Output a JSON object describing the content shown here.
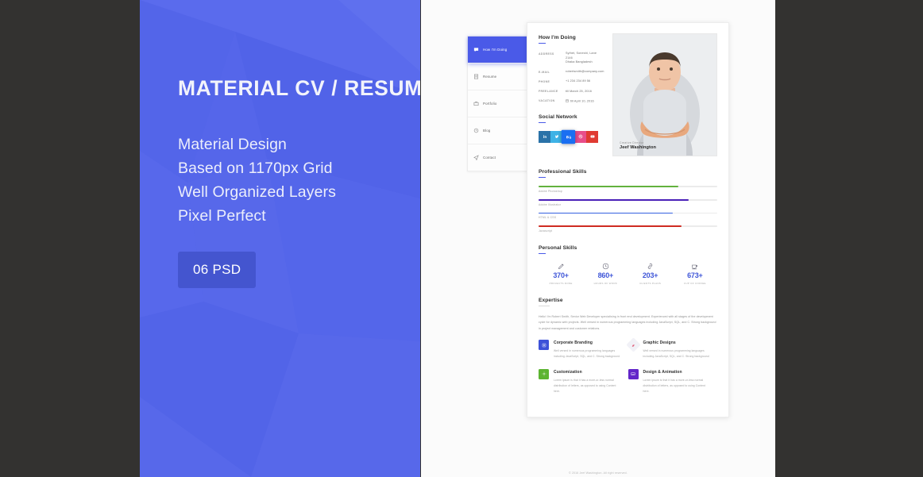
{
  "theme": {
    "promo_blue": "#5566ea",
    "badge_blue": "#4455cf",
    "accent": "#4a5ae8",
    "counter_blue": "#3f56d8",
    "page_bg": "#333230"
  },
  "promo": {
    "title": "MATERIAL CV / RESUME",
    "features": [
      "Material Design",
      "Based on 1170px Grid",
      "Well Organized Layers",
      "Pixel Perfect"
    ],
    "badge": "06 PSD"
  },
  "preview": {
    "nav": [
      {
        "label": "How I'm Doing",
        "icon": "chat-icon",
        "active": true
      },
      {
        "label": "Resume",
        "icon": "document-icon",
        "active": false
      },
      {
        "label": "Portfolio",
        "icon": "briefcase-icon",
        "active": false
      },
      {
        "label": "Blog",
        "icon": "comment-icon",
        "active": false
      },
      {
        "label": "Contact",
        "icon": "send-icon",
        "active": false
      }
    ],
    "header": {
      "title": "How I'm Doing",
      "contact": [
        {
          "key": "ADDRESS",
          "lines": [
            "Sylhet, Soneshi, Lane 2146",
            "Dhaka Bangladesh"
          ]
        },
        {
          "key": "E-MAIL",
          "lines": [
            "robertsmith@company.com"
          ]
        },
        {
          "key": "PHONE",
          "lines": [
            "+1 234 234 89 56"
          ]
        },
        {
          "key": "FREELANCE",
          "lines": [
            "till March 25, 2016"
          ]
        },
        {
          "key": "VACATION",
          "lines": [
            "till April 10, 2016"
          ],
          "icon": "calendar-icon"
        }
      ],
      "social_title": "Social Network",
      "socials": [
        {
          "name": "linkedin-icon",
          "color": "#2a72a8",
          "raised": false
        },
        {
          "name": "twitter-icon",
          "color": "#3eb2e6",
          "raised": false
        },
        {
          "name": "behance-icon",
          "color": "#1a6ff2",
          "raised": true
        },
        {
          "name": "dribbble-icon",
          "color": "#e84d8a",
          "raised": false
        },
        {
          "name": "youtube-icon",
          "color": "#e03a32",
          "raised": false
        }
      ],
      "portrait": {
        "role": "Creative Director",
        "name": "Jeef Washington"
      }
    },
    "professional_skills": {
      "title": "Professional Skills",
      "items": [
        {
          "label": "Adobe Photoshop",
          "value": 78,
          "color": "#62b23e"
        },
        {
          "label": "Adobe Illustrator",
          "value": 84,
          "color": "#4a20b8"
        },
        {
          "label": "HTML & CSS",
          "value": 75,
          "color": "#3560e0"
        },
        {
          "label": "Javascript",
          "value": 80,
          "color": "#cf2b22"
        }
      ]
    },
    "personal_skills": {
      "title": "Personal Skills",
      "counters": [
        {
          "icon": "pen-icon",
          "value": "370+",
          "label": "PROJECTS DONE"
        },
        {
          "icon": "clock-icon",
          "value": "860+",
          "label": "HOURS OF WORK"
        },
        {
          "icon": "link-icon",
          "value": "203+",
          "label": "CLIENTS PLANS"
        },
        {
          "icon": "coffee-icon",
          "value": "673+",
          "label": "CUP OF COFFEE"
        }
      ]
    },
    "expertise": {
      "title": "Expertise",
      "intro": "Hello! I'm Robert Smith, Senior Web Developer specialising in front end development. Experienced with all stages of the development cycle for dynamic web projects. Well versed in numerous programming languages including JavaScript, SQL, and C. Strong background in project management and customer relations.",
      "items": [
        {
          "icon": "branding-icon",
          "color": "#3d52d8",
          "shape": "square",
          "title": "Corporate Branding",
          "text": "Well versed in numerous programming languages including JavaScript, SQL, and C. Strong background"
        },
        {
          "icon": "pen-nib-icon",
          "color": "#f1f1f7",
          "shape": "diamond",
          "title": "Graphic Designs",
          "text": "Well versed in numerous programming languages including JavaScript, SQL, and C. Strong background"
        },
        {
          "icon": "gear-icon",
          "color": "#5cb431",
          "shape": "square",
          "title": "Customization",
          "text": "Lorem Ipsum is that it has a more-or-less normal distribution of letters, as opposed to using Content here."
        },
        {
          "icon": "image-icon",
          "color": "#6226c9",
          "shape": "square",
          "title": "Design & Animation",
          "text": "Lorem Ipsum is that it has a more-or-less normal distribution of letters, as opposed to using Content here."
        }
      ]
    },
    "footer": "© 2016 Jeef Washington. All right reserved."
  }
}
